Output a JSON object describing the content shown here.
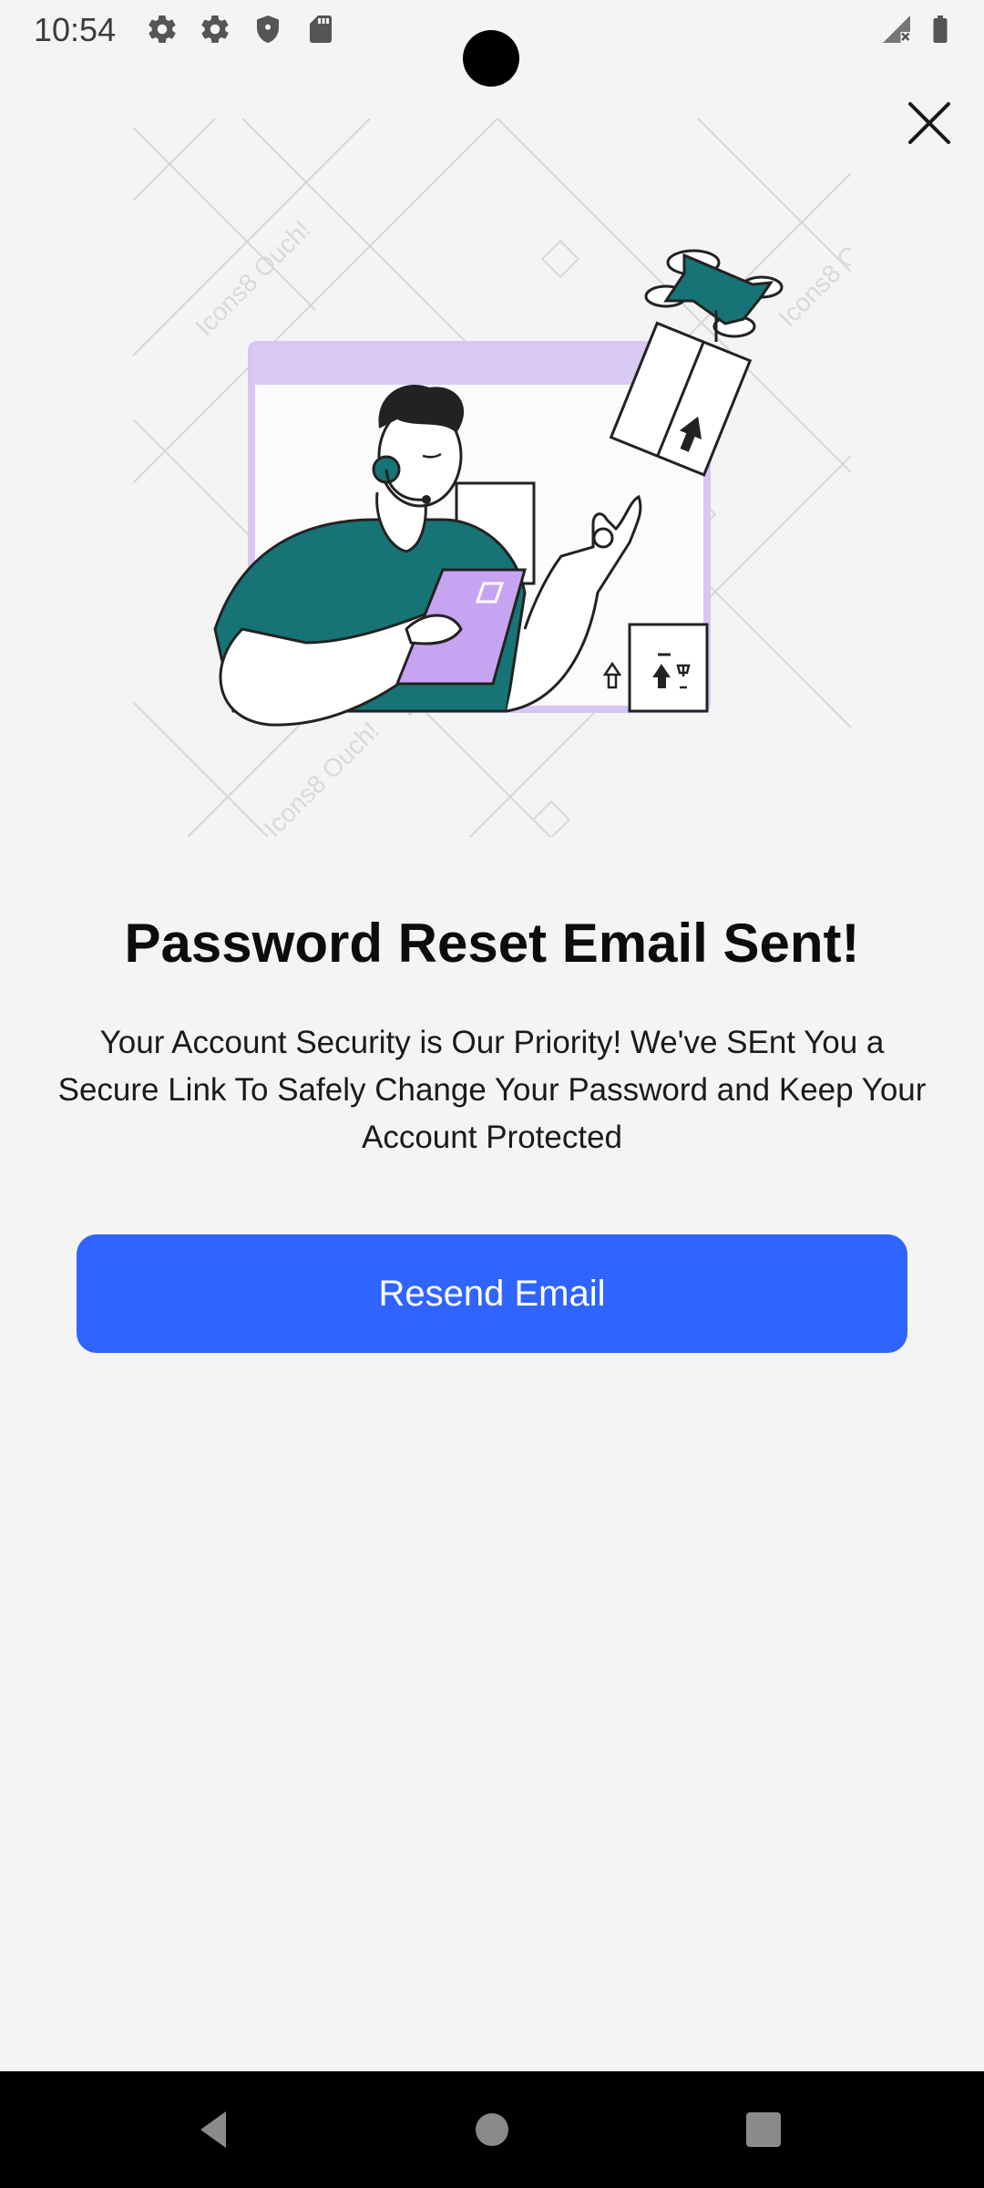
{
  "status_bar": {
    "time": "10:54",
    "icons": [
      "settings-icon",
      "settings-icon",
      "shield-icon",
      "sd-card-icon",
      "signal-icon",
      "battery-icon"
    ]
  },
  "dialog": {
    "close_icon": "close-icon",
    "title": "Password Reset Email Sent!",
    "message": "Your Account Security is Our Priority! We've SEnt You a Secure Link To Safely Change Your Password and Keep Your Account Protected",
    "resend_button_label": "Resend Email",
    "accent_color": "#2f64ff"
  },
  "illustration": {
    "watermark": "Icons8 Ouch!"
  },
  "nav_bar": {
    "buttons": [
      "back-icon",
      "home-icon",
      "recents-icon"
    ]
  }
}
